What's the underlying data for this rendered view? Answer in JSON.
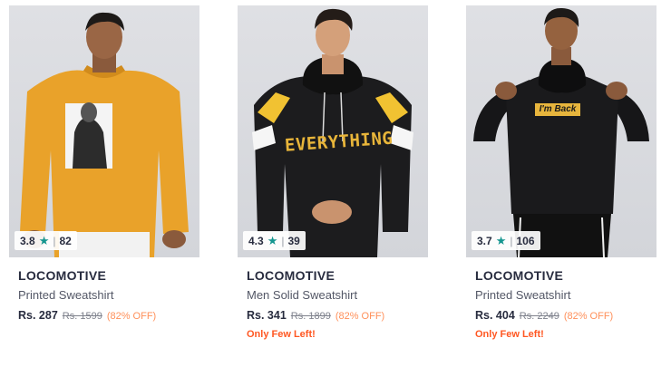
{
  "products": [
    {
      "brand": "LOCOMOTIVE",
      "name": "Printed Sweatshirt",
      "rating": "3.8",
      "reviews": "82",
      "price": "Rs. 287",
      "mrp": "Rs. 1599",
      "discount": "(82% OFF)",
      "stock_note": ""
    },
    {
      "brand": "LOCOMOTIVE",
      "name": "Men Solid Sweatshirt",
      "rating": "4.3",
      "reviews": "39",
      "price": "Rs. 341",
      "mrp": "Rs. 1899",
      "discount": "(82% OFF)",
      "stock_note": "Only Few Left!",
      "print_text": "EVERYTHING"
    },
    {
      "brand": "LOCOMOTIVE",
      "name": "Printed Sweatshirt",
      "rating": "3.7",
      "reviews": "106",
      "price": "Rs. 404",
      "mrp": "Rs. 2249",
      "discount": "(82% OFF)",
      "stock_note": "Only Few Left!",
      "print_text": "I'm Back"
    }
  ],
  "colors": {
    "rating_star": "#14958f",
    "discount": "#ff905a",
    "stock_note": "#ff5722",
    "brand_text": "#282c3f"
  },
  "icons": [
    "star-icon"
  ]
}
